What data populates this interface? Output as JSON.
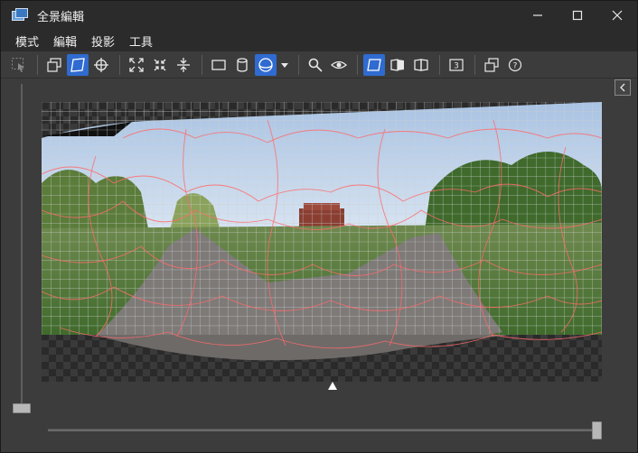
{
  "window": {
    "title": "全景編輯",
    "controls": {
      "minimize": "—",
      "maximize": "☐",
      "close": "✕"
    }
  },
  "menu": {
    "items": [
      "模式",
      "編輯",
      "投影",
      "工具"
    ]
  },
  "toolbar": {
    "groups": [
      [
        "select-region-icon"
      ],
      [
        "frame-mode-icon",
        "perspective-mode-icon",
        "crosshair-icon"
      ],
      [
        "fit-expand-icon",
        "fit-contract-icon",
        "vertical-fit-icon"
      ],
      [
        "rectilinear-projection-icon",
        "cylindrical-projection-icon",
        "spherical-projection-icon",
        "dropdown-arrow-icon"
      ],
      [
        "zoom-icon",
        "eye-icon"
      ],
      [
        "view-normal-icon",
        "view-left-mirror-icon",
        "view-right-mirror-icon"
      ],
      [
        "numbered-overlay-icon"
      ],
      [
        "layers-icon",
        "help-icon"
      ]
    ],
    "active": [
      "perspective-mode-icon",
      "spherical-projection-icon",
      "view-normal-icon"
    ],
    "badge_number": "3",
    "help_glyph": "?"
  },
  "colors": {
    "accent": "#2f6bd0",
    "seam_lines": "#ff6666",
    "grid": "#c8c8c8"
  },
  "sliders": {
    "vertical_level": 0.0,
    "horizontal_level": 1.0
  }
}
